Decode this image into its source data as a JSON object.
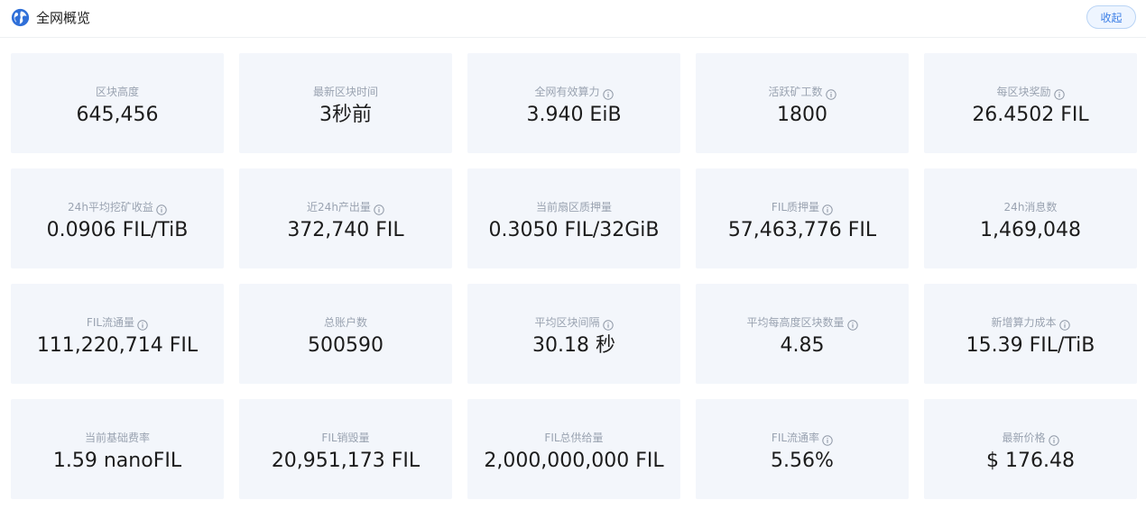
{
  "header": {
    "title": "全网概览",
    "collapse_label": "收起",
    "icon": "globe-icon"
  },
  "colors": {
    "card_bg": "#f3f6fb",
    "label": "#9aa3b1",
    "value": "#1c1c1c",
    "accent": "#3b7ee6"
  },
  "stats": [
    {
      "label": "区块高度",
      "value": "645,456",
      "info": false
    },
    {
      "label": "最新区块时间",
      "value": "3秒前",
      "info": false
    },
    {
      "label": "全网有效算力",
      "value": "3.940 EiB",
      "info": true
    },
    {
      "label": "活跃矿工数",
      "value": "1800",
      "info": true
    },
    {
      "label": "每区块奖励",
      "value": "26.4502 FIL",
      "info": true
    },
    {
      "label": "24h平均挖矿收益",
      "value": "0.0906 FIL/TiB",
      "info": true
    },
    {
      "label": "近24h产出量",
      "value": "372,740 FIL",
      "info": true
    },
    {
      "label": "当前扇区质押量",
      "value": "0.3050 FIL/32GiB",
      "info": false
    },
    {
      "label": "FIL质押量",
      "value": "57,463,776 FIL",
      "info": true
    },
    {
      "label": "24h消息数",
      "value": "1,469,048",
      "info": false
    },
    {
      "label": "FIL流通量",
      "value": "111,220,714 FIL",
      "info": true
    },
    {
      "label": "总账户数",
      "value": "500590",
      "info": false
    },
    {
      "label": "平均区块间隔",
      "value": "30.18 秒",
      "info": true
    },
    {
      "label": "平均每高度区块数量",
      "value": "4.85",
      "info": true
    },
    {
      "label": "新增算力成本",
      "value": "15.39 FIL/TiB",
      "info": true
    },
    {
      "label": "当前基础费率",
      "value": "1.59 nanoFIL",
      "info": false
    },
    {
      "label": "FIL销毁量",
      "value": "20,951,173 FIL",
      "info": false
    },
    {
      "label": "FIL总供给量",
      "value": "2,000,000,000 FIL",
      "info": false
    },
    {
      "label": "FIL流通率",
      "value": "5.56%",
      "info": true
    },
    {
      "label": "最新价格",
      "value": "$ 176.48",
      "info": true
    }
  ]
}
